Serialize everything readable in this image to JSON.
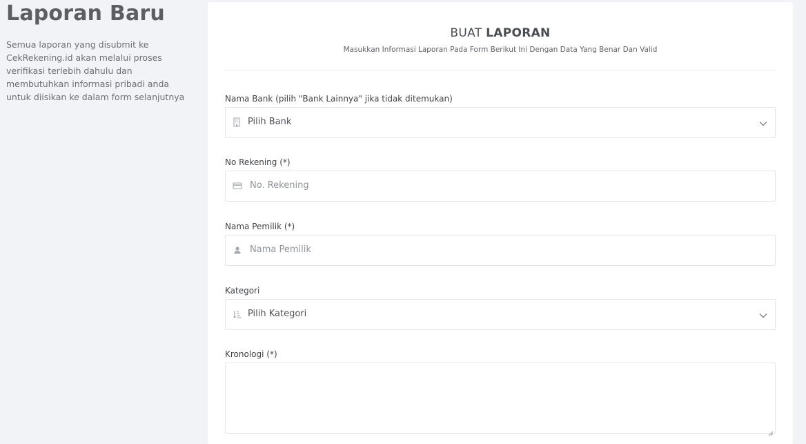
{
  "intro": {
    "title": "Laporan Baru",
    "description": "Semua laporan yang disubmit ke CekRekening.id akan melalui proses verifikasi terlebih dahulu dan membutuhkan informasi pribadi anda untuk diisikan ke dalam form selanjutnya"
  },
  "form": {
    "title_light": "BUAT",
    "title_bold": "LAPORAN",
    "subtitle": "Masukkan Informasi Laporan Pada Form Berikut Ini Dengan Data Yang Benar Dan Valid",
    "fields": {
      "bank": {
        "label": "Nama Bank (pilih \"Bank Lainnya\" jika tidak ditemukan)",
        "value": "Pilih Bank",
        "icon": "bank-icon"
      },
      "rekening": {
        "label": "No Rekening (*)",
        "placeholder": "No. Rekening",
        "icon": "credit-card-icon"
      },
      "pemilik": {
        "label": "Nama Pemilik (*)",
        "placeholder": "Nama Pemilik",
        "icon": "user-icon"
      },
      "kategori": {
        "label": "Kategori",
        "value": "Pilih Kategori",
        "icon": "sort-list-icon"
      },
      "kronologi": {
        "label": "Kronologi (*)",
        "value": ""
      }
    }
  },
  "colors": {
    "background": "#f2f3f6",
    "card": "#ffffff",
    "border": "#e2e5e9",
    "heading": "#5b5e63"
  }
}
